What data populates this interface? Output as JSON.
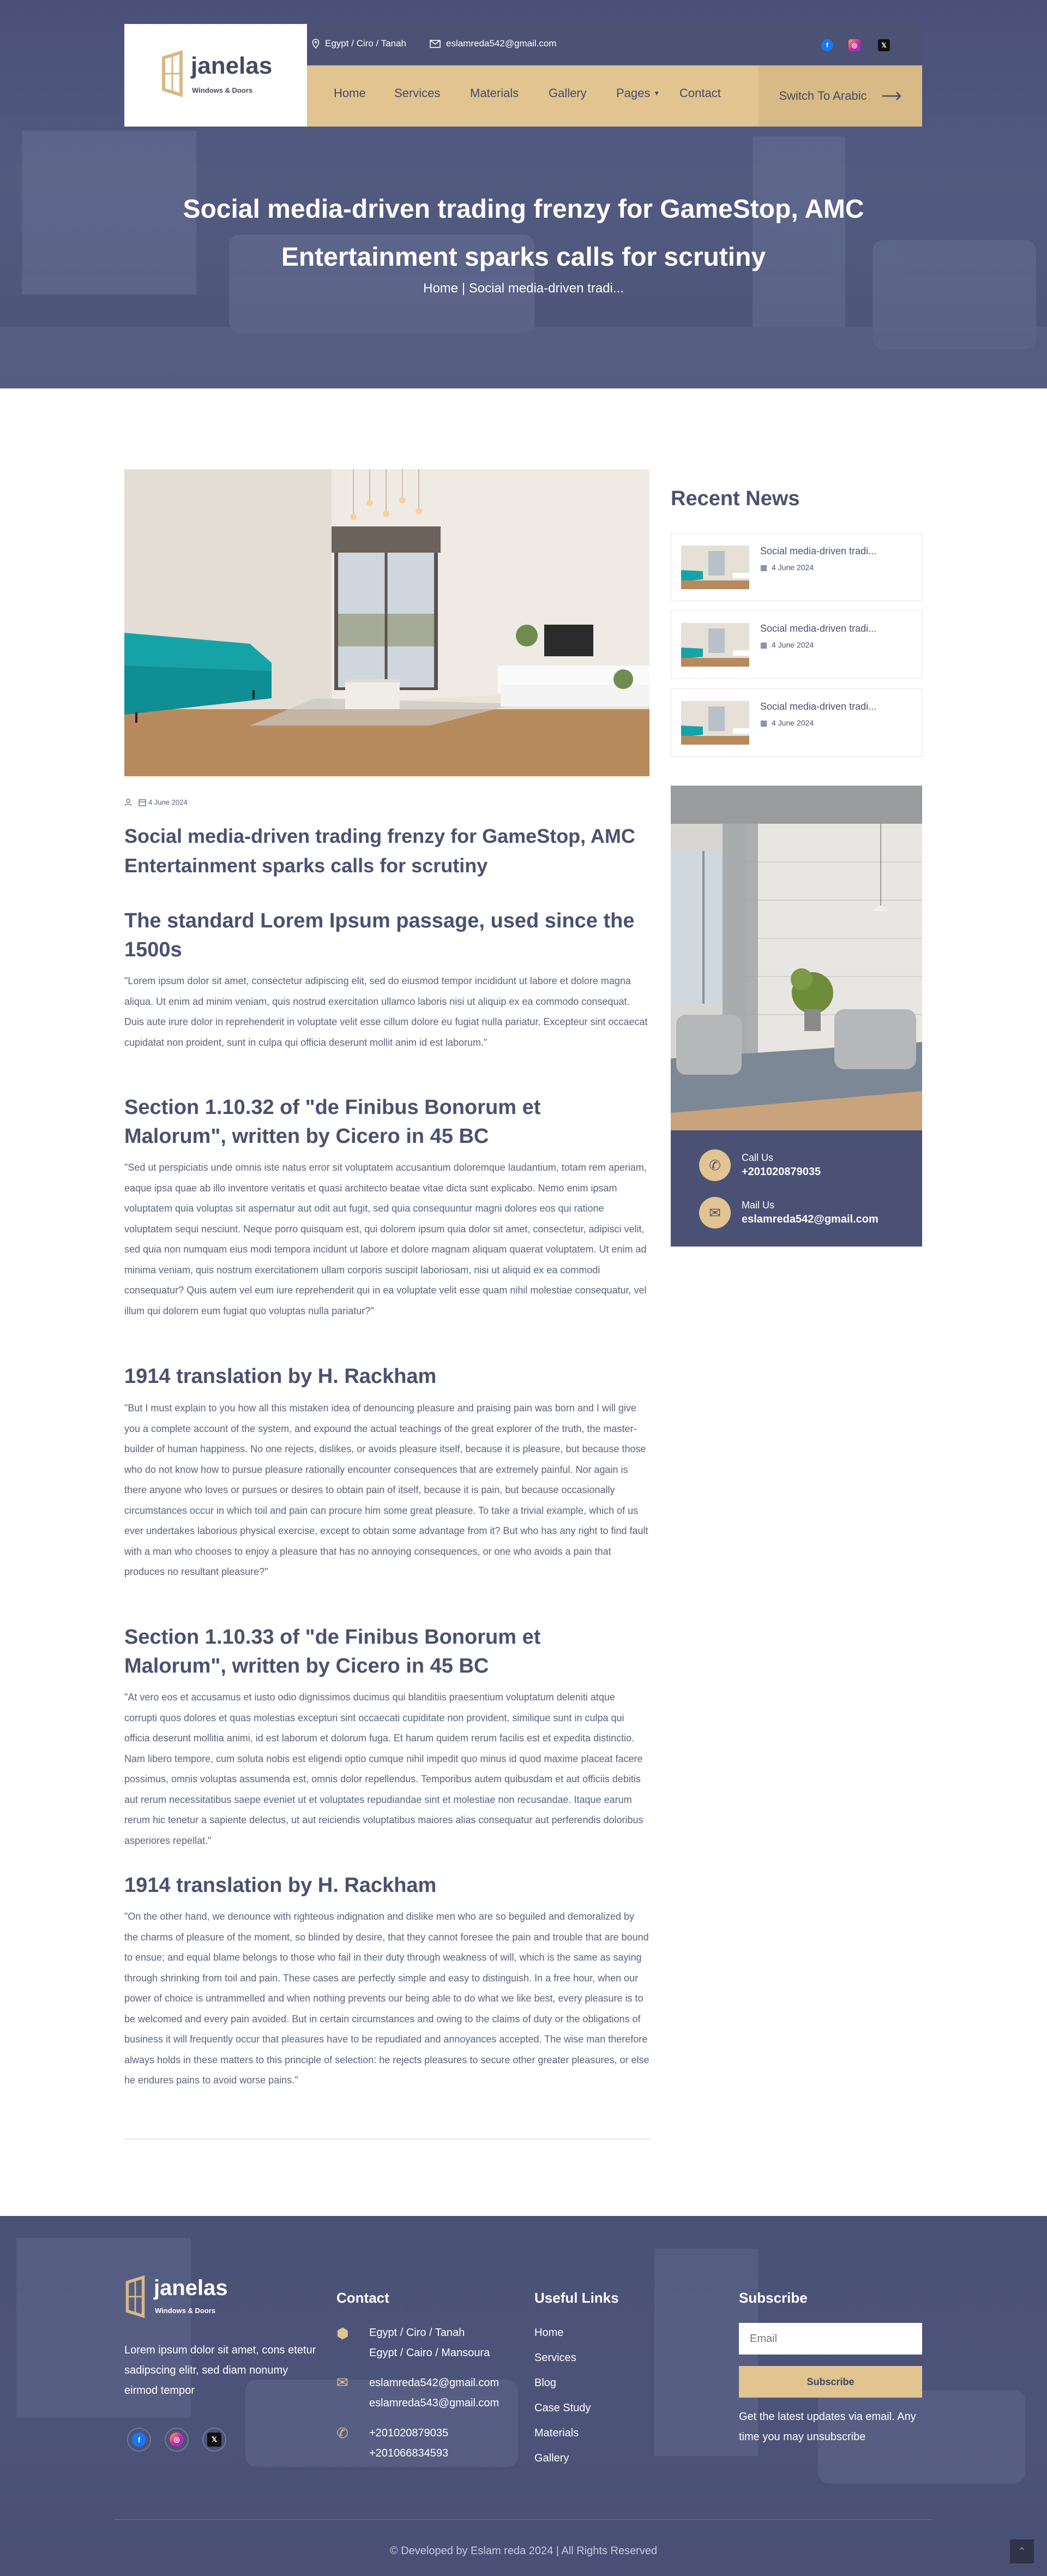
{
  "topbar": {
    "location": "Egypt / Ciro / Tanah",
    "email": "eslamreda542@gmail.com",
    "social": [
      "facebook-icon",
      "instagram-icon",
      "x-icon"
    ]
  },
  "brand": {
    "name": "janelas",
    "tagline": "Windows & Doors"
  },
  "nav": {
    "items": [
      "Home",
      "Services",
      "Materials",
      "Gallery",
      "Pages",
      "Contact"
    ],
    "switch_label": "Switch To Arabic"
  },
  "hero": {
    "title": "Social media-driven trading frenzy for GameStop, AMC Entertainment sparks calls for scrutiny",
    "crumb_home": "Home",
    "crumb_sep": "|",
    "crumb_current": "Social media-driven tradi..."
  },
  "post": {
    "date": "4 June 2024",
    "title": "Social media-driven trading frenzy for GameStop, AMC Entertainment sparks calls for scrutiny",
    "sections": [
      {
        "heading": "The standard Lorem Ipsum passage, used since the 1500s",
        "body": "\"Lorem ipsum dolor sit amet, consectetur adipiscing elit, sed do eiusmod tempor incididunt ut labore et dolore magna aliqua. Ut enim ad minim veniam, quis nostrud exercitation ullamco laboris nisi ut aliquip ex ea commodo consequat. Duis aute irure dolor in reprehenderit in voluptate velit esse cillum dolore eu fugiat nulla pariatur. Excepteur sint occaecat cupidatat non proident, sunt in culpa qui officia deserunt mollit anim id est laborum.\""
      },
      {
        "heading": "Section 1.10.32 of \"de Finibus Bonorum et Malorum\", written by Cicero in 45 BC",
        "body": "\"Sed ut perspiciatis unde omnis iste natus error sit voluptatem accusantium doloremque laudantium, totam rem aperiam, eaque ipsa quae ab illo inventore veritatis et quasi architecto beatae vitae dicta sunt explicabo. Nemo enim ipsam voluptatem quia voluptas sit aspernatur aut odit aut fugit, sed quia consequuntur magni dolores eos qui ratione voluptatem sequi nesciunt. Neque porro quisquam est, qui dolorem ipsum quia dolor sit amet, consectetur, adipisci velit, sed quia non numquam eius modi tempora incidunt ut labore et dolore magnam aliquam quaerat voluptatem. Ut enim ad minima veniam, quis nostrum exercitationem ullam corporis suscipit laboriosam, nisi ut aliquid ex ea commodi consequatur? Quis autem vel eum iure reprehenderit qui in ea voluptate velit esse quam nihil molestiae consequatur, vel illum qui dolorem eum fugiat quo voluptas nulla pariatur?\""
      },
      {
        "heading": "1914 translation by H. Rackham",
        "body": "\"But I must explain to you how all this mistaken idea of denouncing pleasure and praising pain was born and I will give you a complete account of the system, and expound the actual teachings of the great explorer of the truth, the master-builder of human happiness. No one rejects, dislikes, or avoids pleasure itself, because it is pleasure, but because those who do not know how to pursue pleasure rationally encounter consequences that are extremely painful. Nor again is there anyone who loves or pursues or desires to obtain pain of itself, because it is pain, but because occasionally circumstances occur in which toil and pain can procure him some great pleasure. To take a trivial example, which of us ever undertakes laborious physical exercise, except to obtain some advantage from it? But who has any right to find fault with a man who chooses to enjoy a pleasure that has no annoying consequences, or one who avoids a pain that produces no resultant pleasure?\""
      },
      {
        "heading": "Section 1.10.33 of \"de Finibus Bonorum et Malorum\", written by Cicero in 45 BC",
        "body": "\"At vero eos et accusamus et iusto odio dignissimos ducimus qui blanditiis praesentium voluptatum deleniti atque corrupti quos dolores et quas molestias excepturi sint occaecati cupiditate non provident, similique sunt in culpa qui officia deserunt mollitia animi, id est laborum et dolorum fuga. Et harum quidem rerum facilis est et expedita distinctio. Nam libero tempore, cum soluta nobis est eligendi optio cumque nihil impedit quo minus id quod maxime placeat facere possimus, omnis voluptas assumenda est, omnis dolor repellendus. Temporibus autem quibusdam et aut officiis debitis aut rerum necessitatibus saepe eveniet ut et voluptates repudiandae sint et molestiae non recusandae. Itaque earum rerum hic tenetur a sapiente delectus, ut aut reiciendis voluptatibus maiores alias consequatur aut perferendis doloribus asperiores repellat.\""
      },
      {
        "heading": "1914 translation by H. Rackham",
        "body": "\"On the other hand, we denounce with righteous indignation and dislike men who are so beguiled and demoralized by the charms of pleasure of the moment, so blinded by desire, that they cannot foresee the pain and trouble that are bound to ensue; and equal blame belongs to those who fail in their duty through weakness of will, which is the same as saying through shrinking from toil and pain. These cases are perfectly simple and easy to distinguish. In a free hour, when our power of choice is untrammelled and when nothing prevents our being able to do what we like best, every pleasure is to be welcomed and every pain avoided. But in certain circumstances and owing to the claims of duty or the obligations of business it will frequently occur that pleasures have to be repudiated and annoyances accepted. The wise man therefore always holds in these matters to this principle of selection: he rejects pleasures to secure other greater pleasures, or else he endures pains to avoid worse pains.\""
      }
    ]
  },
  "sidebar": {
    "recent_title": "Recent News",
    "recent": [
      {
        "title": "Social media-driven tradi...",
        "date": "4 June 2024"
      },
      {
        "title": "Social media-driven tradi...",
        "date": "4 June 2024"
      },
      {
        "title": "Social media-driven tradi...",
        "date": "4 June 2024"
      }
    ],
    "call_label": "Call Us",
    "call_value": "+201020879035",
    "mail_label": "Mail Us",
    "mail_value": "eslamreda542@gmail.com"
  },
  "footer": {
    "about": "Lorem ipsum dolor sit amet, cons etetur sadipscing elitr, sed diam nonumy eirmod tempor",
    "contact_title": "Contact",
    "address1": "Egypt / Ciro / Tanah",
    "address2": "Egypt / Cairo / Mansoura",
    "email1": "eslamreda542@gmail.com",
    "email2": "eslamreda543@gmail.com",
    "phone1": "+201020879035",
    "phone2": "+201066834593",
    "links_title": "Useful Links",
    "links": [
      "Home",
      "Services",
      "Blog",
      "Case Study",
      "Materials",
      "Gallery"
    ],
    "subscribe_title": "Subscribe",
    "email_placeholder": "Email",
    "subscribe_button": "Subscribe",
    "subscribe_note": "Get the latest updates via email. Any time you may unsubscribe",
    "copyright": "© Developed by Eslam reda  2024 | All Rights Reserved"
  },
  "colors": {
    "accent": "#e2c491",
    "navy": "#4a5174"
  }
}
